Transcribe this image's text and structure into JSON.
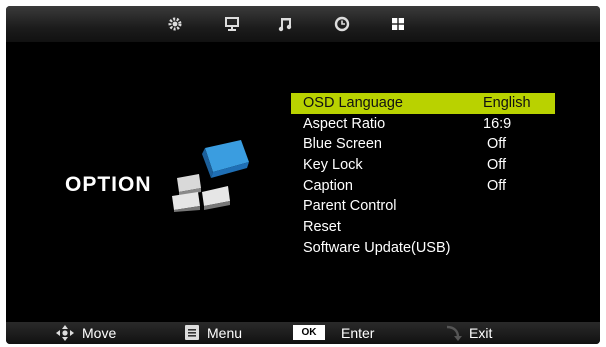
{
  "topbar": {
    "icons": [
      "gear-icon",
      "monitor-icon",
      "music-note-icon",
      "clock-icon",
      "option-grid-icon"
    ]
  },
  "page_title": "OPTION",
  "menu": {
    "items": [
      {
        "label": "OSD Language",
        "value": "English",
        "selected": true
      },
      {
        "label": "Aspect Ratio",
        "value": "16:9"
      },
      {
        "label": "Blue Screen",
        "value": "Off"
      },
      {
        "label": "Key Lock",
        "value": "Off"
      },
      {
        "label": "Caption",
        "value": "Off"
      },
      {
        "label": "Parent Control",
        "value": ""
      },
      {
        "label": "Reset",
        "value": ""
      },
      {
        "label": "Software Update(USB)",
        "value": ""
      }
    ]
  },
  "bottombar": {
    "move_label": "Move",
    "menu_label": "Menu",
    "ok_badge": "OK",
    "enter_label": "Enter",
    "exit_label": "Exit"
  },
  "colors": {
    "highlight": "#b9d200",
    "background": "#000000",
    "icon_blue": "#3a9de0"
  }
}
